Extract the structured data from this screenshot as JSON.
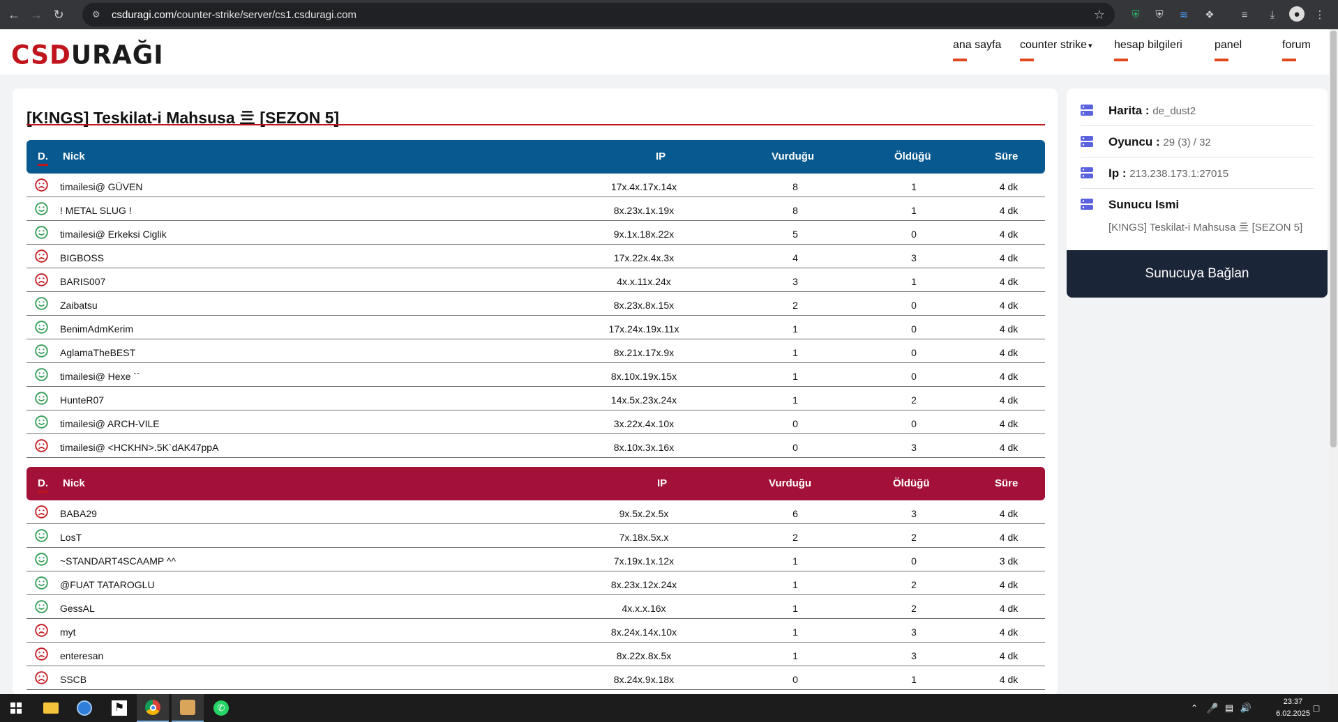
{
  "browser": {
    "url_host": "csduragi.com",
    "url_path": "/counter-strike/server/cs1.csduragi.com"
  },
  "site": {
    "logo_part1": "CSD",
    "logo_part2": "URAĞI",
    "nav": [
      "ana sayfa",
      "counter strike",
      "hesap bilgileri",
      "panel",
      "forum"
    ],
    "dropdown_icon": "chevron-down-icon"
  },
  "server": {
    "title": "[K!NGS] Teskilat-i Mahsusa 亖 [SEZON 5]"
  },
  "table_headers": {
    "status": "D.",
    "nick": "Nick",
    "ip": "IP",
    "hits": "Vurduğu",
    "deaths": "Öldüğü",
    "time": "Süre"
  },
  "team_ct": [
    {
      "alive": false,
      "nick": "timailesi@ GÜVEN",
      "ip": "17x.4x.17x.14x",
      "hits": "8",
      "deaths": "1",
      "time": "4 dk"
    },
    {
      "alive": true,
      "nick": "! METAL SLUG !",
      "ip": "8x.23x.1x.19x",
      "hits": "8",
      "deaths": "1",
      "time": "4 dk"
    },
    {
      "alive": true,
      "nick": "timailesi@ Erkeksi Ciglik",
      "ip": "9x.1x.18x.22x",
      "hits": "5",
      "deaths": "0",
      "time": "4 dk"
    },
    {
      "alive": false,
      "nick": "BIGBOSS",
      "ip": "17x.22x.4x.3x",
      "hits": "4",
      "deaths": "3",
      "time": "4 dk"
    },
    {
      "alive": false,
      "nick": "BARIS007",
      "ip": "4x.x.11x.24x",
      "hits": "3",
      "deaths": "1",
      "time": "4 dk"
    },
    {
      "alive": true,
      "nick": "Zaibatsu",
      "ip": "8x.23x.8x.15x",
      "hits": "2",
      "deaths": "0",
      "time": "4 dk"
    },
    {
      "alive": true,
      "nick": "BenimAdmKerim",
      "ip": "17x.24x.19x.11x",
      "hits": "1",
      "deaths": "0",
      "time": "4 dk"
    },
    {
      "alive": true,
      "nick": "AglamaTheBEST",
      "ip": "8x.21x.17x.9x",
      "hits": "1",
      "deaths": "0",
      "time": "4 dk"
    },
    {
      "alive": true,
      "nick": "timailesi@ Hexe ``",
      "ip": "8x.10x.19x.15x",
      "hits": "1",
      "deaths": "0",
      "time": "4 dk"
    },
    {
      "alive": true,
      "nick": "HunteR07",
      "ip": "14x.5x.23x.24x",
      "hits": "1",
      "deaths": "2",
      "time": "4 dk"
    },
    {
      "alive": true,
      "nick": "timailesi@ ARCH-VILE",
      "ip": "3x.22x.4x.10x",
      "hits": "0",
      "deaths": "0",
      "time": "4 dk"
    },
    {
      "alive": false,
      "nick": "timailesi@ <HCKHN>.5K`dAK47ppA",
      "ip": "8x.10x.3x.16x",
      "hits": "0",
      "deaths": "3",
      "time": "4 dk"
    }
  ],
  "team_t": [
    {
      "alive": false,
      "nick": "BABA29",
      "ip": "9x.5x.2x.5x",
      "hits": "6",
      "deaths": "3",
      "time": "4 dk"
    },
    {
      "alive": true,
      "nick": "LosT",
      "ip": "7x.18x.5x.x",
      "hits": "2",
      "deaths": "2",
      "time": "4 dk"
    },
    {
      "alive": true,
      "nick": "~STANDART4SCAAMP ^^",
      "ip": "7x.19x.1x.12x",
      "hits": "1",
      "deaths": "0",
      "time": "3 dk"
    },
    {
      "alive": true,
      "nick": "@FUAT TATAROGLU",
      "ip": "8x.23x.12x.24x",
      "hits": "1",
      "deaths": "2",
      "time": "4 dk"
    },
    {
      "alive": true,
      "nick": "GessAL",
      "ip": "4x.x.x.16x",
      "hits": "1",
      "deaths": "2",
      "time": "4 dk"
    },
    {
      "alive": false,
      "nick": "myt",
      "ip": "8x.24x.14x.10x",
      "hits": "1",
      "deaths": "3",
      "time": "4 dk"
    },
    {
      "alive": false,
      "nick": "enteresan",
      "ip": "8x.22x.8x.5x",
      "hits": "1",
      "deaths": "3",
      "time": "4 dk"
    },
    {
      "alive": false,
      "nick": "SSCB",
      "ip": "8x.24x.9x.18x",
      "hits": "0",
      "deaths": "1",
      "time": "4 dk"
    }
  ],
  "info": {
    "map_label": "Harita :",
    "map_value": "de_dust2",
    "players_label": "Oyuncu :",
    "players_value": "29 (3) / 32",
    "ip_label": "Ip :",
    "ip_value": "213.238.173.1:27015",
    "name_label": "Sunucu Ismi",
    "name_value": "[K!NGS] Teskilat-i Mahsusa 亖 [SEZON 5]",
    "connect_button": "Sunucuya Bağlan"
  },
  "taskbar": {
    "time": "23:37",
    "date": "6.02.2025"
  },
  "colors": {
    "ct_header": "#08598f",
    "t_header": "#a31138",
    "alive": "#2e9b52",
    "dead": "#c0151c",
    "accent": "#e2471d"
  }
}
